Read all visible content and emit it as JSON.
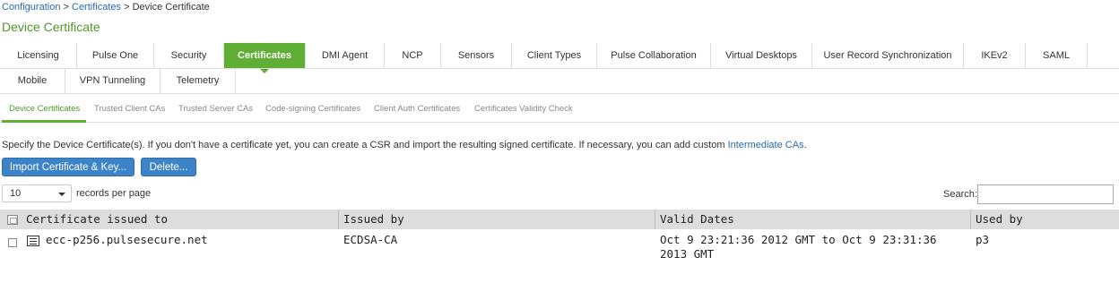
{
  "breadcrumb": {
    "items": [
      "Configuration",
      "Certificates"
    ],
    "separator": ">",
    "current": "Device Certificate"
  },
  "page_title": "Device Certificate",
  "tabs_row1": [
    "Licensing",
    "Pulse One",
    "Security",
    "Certificates",
    "DMI Agent",
    "NCP",
    "Sensors",
    "Client Types",
    "Pulse Collaboration",
    "Virtual Desktops",
    "User Record Synchronization",
    "IKEv2",
    "SAML"
  ],
  "tabs_row2": [
    "Mobile",
    "VPN Tunneling",
    "Telemetry"
  ],
  "active_tab": "Certificates",
  "subtabs": [
    "Device Certificates",
    "Trusted Client CAs",
    "Trusted Server CAs",
    "Code-signing Certificates",
    "Client Auth Certificates",
    "Certificates Validity Check"
  ],
  "description": {
    "text": "Specify the Device Certificate(s). If you don't have a certificate yet, you can create a CSR and import the resulting signed certificate. If necessary, you can add custom ",
    "link": "Intermediate CAs",
    "suffix": "."
  },
  "buttons": {
    "import": "Import Certificate & Key...",
    "delete": "Delete..."
  },
  "pagination": {
    "records_per_page": "10",
    "records_label": "records per page"
  },
  "search": {
    "label": "Search:",
    "value": ""
  },
  "table": {
    "columns": [
      "Certificate issued to",
      "Issued by",
      "Valid Dates",
      "Used by"
    ],
    "rows": [
      {
        "issued_to": "ecc-p256.pulsesecure.net",
        "issued_by": "ECDSA-CA",
        "valid_dates": "Oct 9 23:21:36 2012 GMT to Oct 9 23:31:36 2013 GMT",
        "used_by": "p3"
      }
    ]
  },
  "colors": {
    "accent_green": "#5fae35",
    "title_green": "#4e9a2a",
    "link_blue": "#2a6ab4",
    "button_blue": "#3d83c7"
  }
}
